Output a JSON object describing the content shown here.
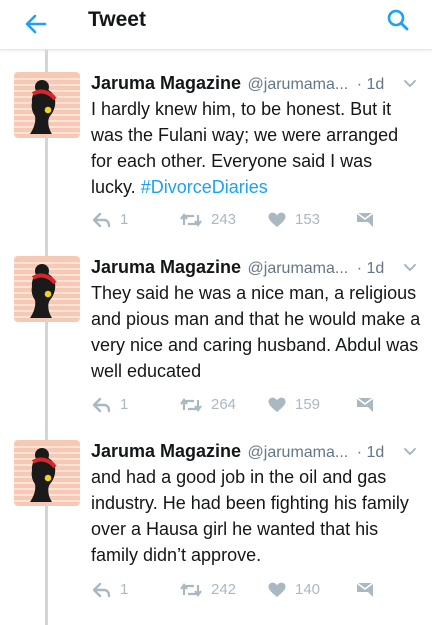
{
  "header": {
    "title": "Tweet",
    "back_icon": "arrow-left-icon",
    "search_icon": "search-icon"
  },
  "colors": {
    "accent": "#1da1f2",
    "muted": "#aab8c2",
    "secondary_text": "#657786",
    "avatar_background": "#f7c9b4"
  },
  "tweets": [
    {
      "author": "Jaruma Magazine",
      "handle": "@jarumama...",
      "separator": "·",
      "time": "1d",
      "text": "I hardly knew him, to be honest. But it was the Fulani way; we were arranged for each other. Everyone said I was lucky.",
      "hashtag": "#DivorceDiaries",
      "replies": "1",
      "retweets": "243",
      "likes": "153"
    },
    {
      "author": "Jaruma Magazine",
      "handle": "@jarumama...",
      "separator": "·",
      "time": "1d",
      "text": "They said he was a nice man, a religious and pious man and that he would make a very nice and caring husband. Abdul was well educated",
      "hashtag": "",
      "replies": "1",
      "retweets": "264",
      "likes": "159"
    },
    {
      "author": "Jaruma Magazine",
      "handle": "@jarumama...",
      "separator": "·",
      "time": "1d",
      "text": "and had a good job in the oil and gas industry. He had been fighting his family over a Hausa girl he wanted that his family didn’t approve.",
      "hashtag": "",
      "replies": "1",
      "retweets": "242",
      "likes": "140"
    }
  ]
}
